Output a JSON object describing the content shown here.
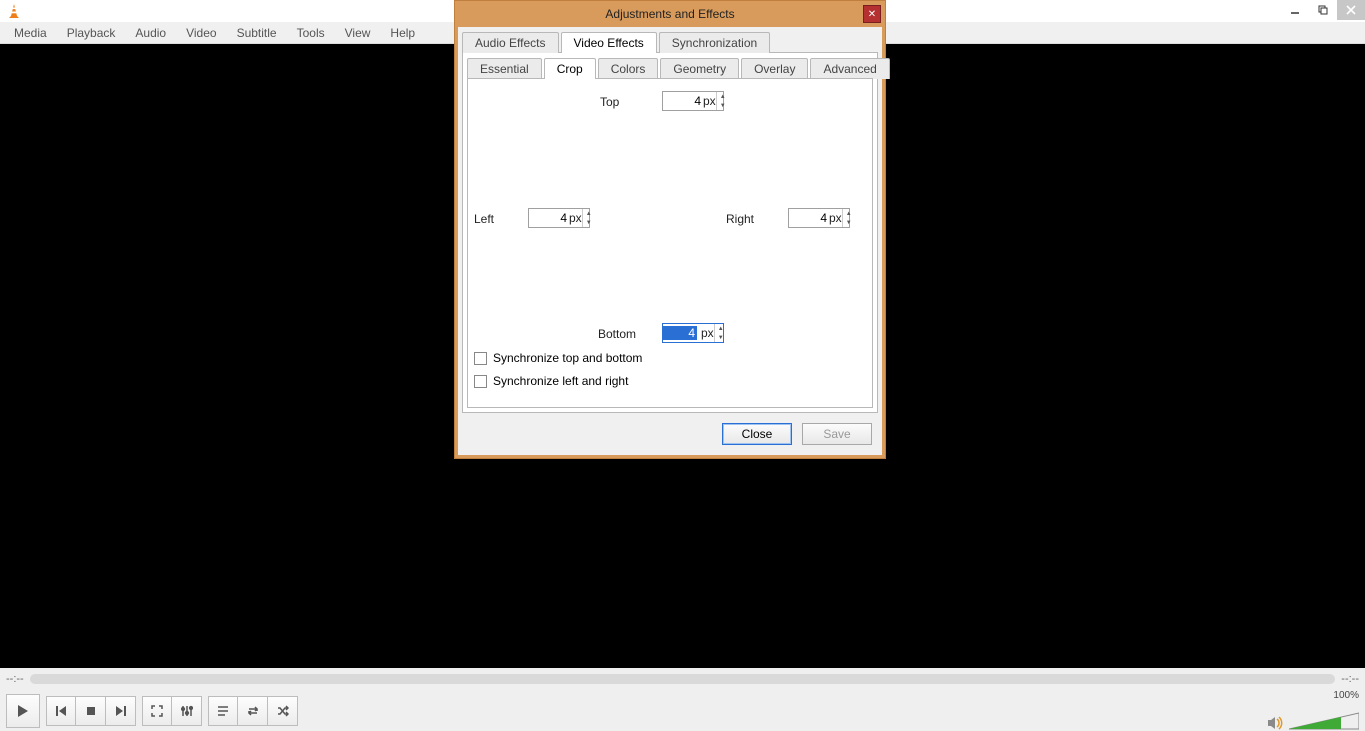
{
  "menu": [
    "Media",
    "Playback",
    "Audio",
    "Video",
    "Subtitle",
    "Tools",
    "View",
    "Help"
  ],
  "time": {
    "left": "--:--",
    "right": "--:--"
  },
  "volume": {
    "label": "100%"
  },
  "dialog": {
    "title": "Adjustments and Effects",
    "tabs": {
      "audio": "Audio Effects",
      "video": "Video Effects",
      "sync": "Synchronization"
    },
    "subtabs": {
      "essential": "Essential",
      "crop": "Crop",
      "colors": "Colors",
      "geometry": "Geometry",
      "overlay": "Overlay",
      "advanced": "Advanced"
    },
    "crop": {
      "top_label": "Top",
      "top_value": "4",
      "left_label": "Left",
      "left_value": "4",
      "right_label": "Right",
      "right_value": "4",
      "bottom_label": "Bottom",
      "bottom_value": "4",
      "unit": "px",
      "sync_tb": "Synchronize top and bottom",
      "sync_lr": "Synchronize left and right"
    },
    "buttons": {
      "close": "Close",
      "save": "Save"
    }
  }
}
